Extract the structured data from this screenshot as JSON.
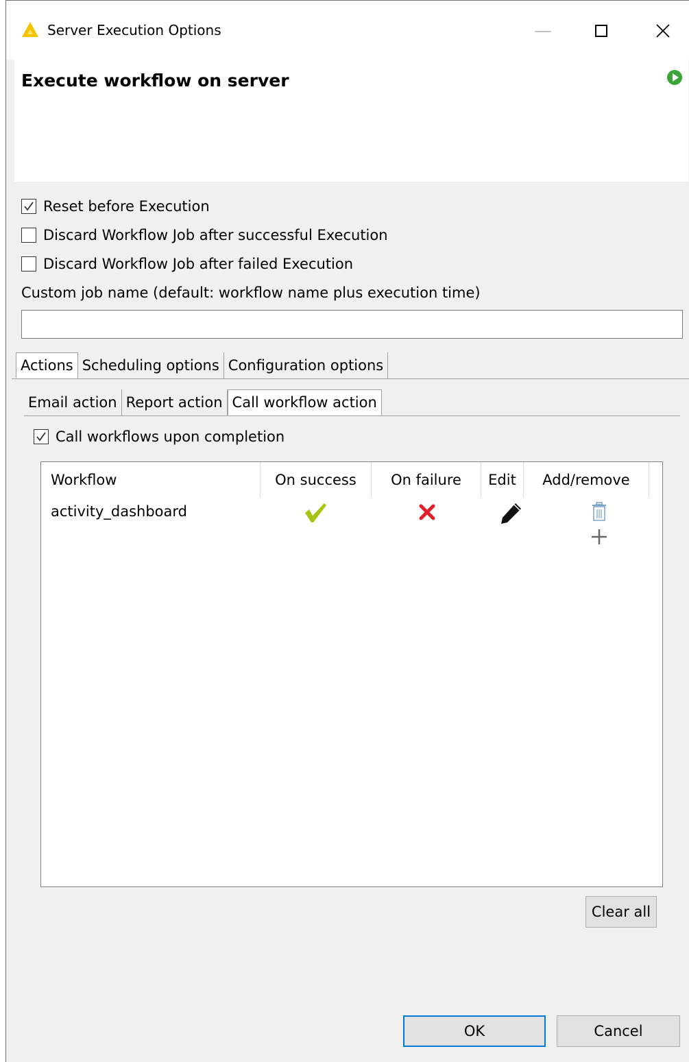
{
  "window": {
    "title": "Server Execution Options",
    "controls": {
      "minimize": "—",
      "close": "✕"
    }
  },
  "banner": {
    "title": "Execute workflow on server"
  },
  "options": [
    {
      "label": "Reset before Execution",
      "checked": true
    },
    {
      "label": "Discard Workflow Job after successful Execution",
      "checked": false
    },
    {
      "label": "Discard Workflow Job after failed Execution",
      "checked": false
    }
  ],
  "job_name": {
    "label": "Custom job name (default: workflow name plus execution time)",
    "value": "",
    "placeholder": ""
  },
  "main_tabs": [
    {
      "label": "Actions",
      "active": true
    },
    {
      "label": "Scheduling options",
      "active": false
    },
    {
      "label": "Configuration options",
      "active": false
    }
  ],
  "sub_tabs": [
    {
      "label": "Email action",
      "active": false
    },
    {
      "label": "Report action",
      "active": false
    },
    {
      "label": "Call workflow action",
      "active": true
    }
  ],
  "call_workflows": {
    "label": "Call workflows upon completion",
    "checked": true
  },
  "table": {
    "headers": [
      "Workflow",
      "On success",
      "On failure",
      "Edit",
      "Add/remove"
    ],
    "rows": [
      {
        "workflow": "activity_dashboard",
        "on_success": "check-icon",
        "on_failure": "cross-icon",
        "edit": "pencil-icon",
        "add_remove": [
          "trash-icon",
          "plus-icon"
        ]
      }
    ]
  },
  "buttons": {
    "clear_all": "Clear all",
    "ok": "OK",
    "cancel": "Cancel"
  },
  "colors": {
    "success": "#a9c414",
    "failure": "#e0202b",
    "run": "#3aa53a",
    "logo": "#f5c400",
    "focus_border": "#0078d7"
  }
}
